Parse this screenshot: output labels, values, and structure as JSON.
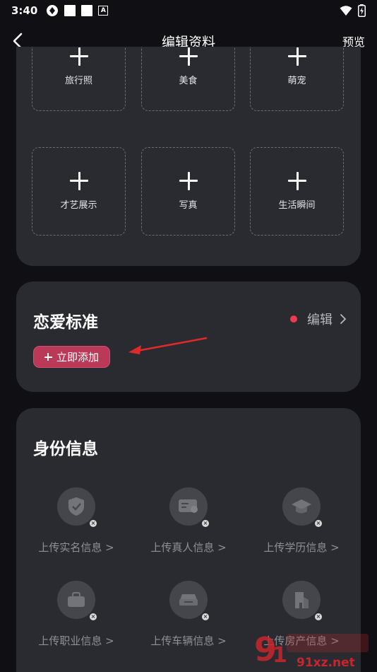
{
  "status": {
    "time": "3:40"
  },
  "nav": {
    "title": "编辑资料",
    "preview": "预览"
  },
  "photos": [
    {
      "label": "旅行照"
    },
    {
      "label": "美食"
    },
    {
      "label": "萌宠"
    },
    {
      "label": "才艺展示"
    },
    {
      "label": "写真"
    },
    {
      "label": "生活瞬间"
    }
  ],
  "love": {
    "title": "恋爱标准",
    "edit": "编辑",
    "add": "立即添加"
  },
  "identity": {
    "title": "身份信息",
    "items": [
      {
        "label": "上传实名信息 >",
        "icon": "shield-icon"
      },
      {
        "label": "上传真人信息 >",
        "icon": "id-card-icon"
      },
      {
        "label": "上传学历信息 >",
        "icon": "graduation-cap-icon"
      },
      {
        "label": "上传职业信息 >",
        "icon": "briefcase-icon"
      },
      {
        "label": "上传车辆信息 >",
        "icon": "car-icon"
      },
      {
        "label": "上传房产信息 >",
        "icon": "house-icon"
      }
    ]
  },
  "watermark": {
    "text": "91xz.net"
  },
  "colors": {
    "background": "#101014",
    "card": "#2a2b31",
    "accent": "#b93a58",
    "dot": "#f2394f"
  }
}
